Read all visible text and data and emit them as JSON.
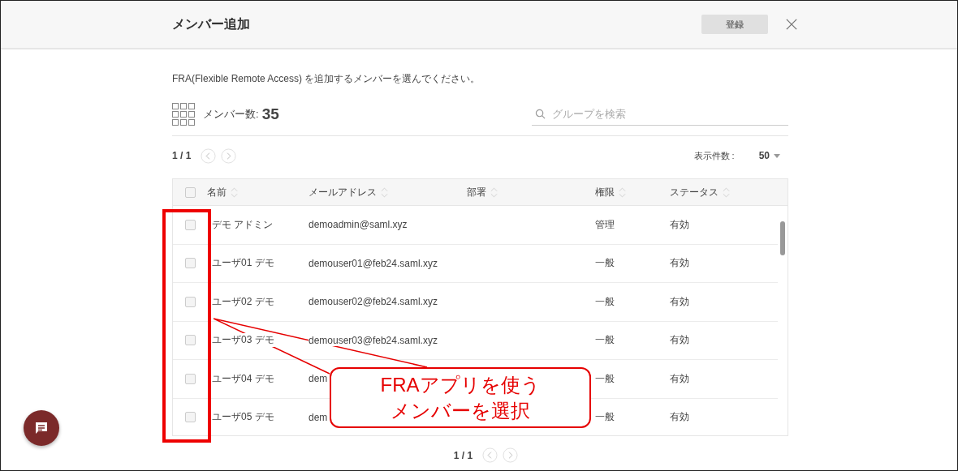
{
  "dialog": {
    "title": "メンバー追加",
    "submit": {
      "label": "登録",
      "disabled": true
    }
  },
  "description": "FRA(Flexible Remote Access) を追加するメンバーを選んでください。",
  "member_count": {
    "label": "メンバー数:",
    "value": "35"
  },
  "search": {
    "placeholder": "グループを検索"
  },
  "pager_top": "1 / 1",
  "page_size": {
    "label": "表示件数 :",
    "value": "50"
  },
  "table": {
    "select_all": {
      "checked": false
    },
    "columns": [
      "名前",
      "メールアドレス",
      "部署",
      "権限",
      "ステータス"
    ],
    "rows": [
      {
        "checked": false,
        "name": "デモ アドミン",
        "email": "demoadmin@saml.xyz",
        "role": "管理",
        "status": "有効"
      },
      {
        "checked": false,
        "name": "ユーザ01 デモ",
        "email": "demouser01@feb24.saml.xyz",
        "role": "一般",
        "status": "有効"
      },
      {
        "checked": false,
        "name": "ユーザ02 デモ",
        "email": "demouser02@feb24.saml.xyz",
        "role": "一般",
        "status": "有効"
      },
      {
        "checked": false,
        "name": "ユーザ03 デモ",
        "email": "demouser03@feb24.saml.xyz",
        "role": "一般",
        "status": "有効"
      },
      {
        "checked": false,
        "name": "ユーザ04 デモ",
        "email": "dem",
        "role": "一般",
        "status": "有効"
      },
      {
        "checked": false,
        "name": "ユーザ05 デモ",
        "email": "dem",
        "role": "一般",
        "status": "有効"
      }
    ]
  },
  "pager_bottom": "1 / 1",
  "callout": [
    "FRAアプリを使う",
    "メンバーを選択"
  ]
}
